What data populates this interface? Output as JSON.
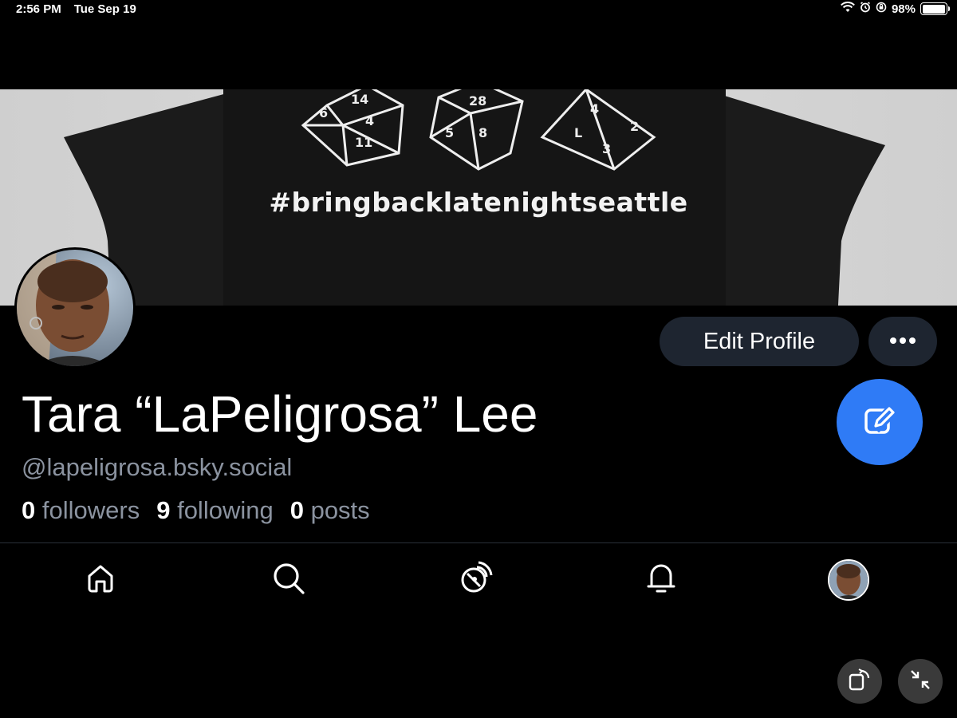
{
  "status_bar": {
    "time": "2:56 PM",
    "date": "Tue Sep 19",
    "battery": "98%",
    "battery_level": 0.98
  },
  "banner": {
    "hashtag": "#bringbacklatenightseattle"
  },
  "profile": {
    "display_name": "Tara “LaPeligrosa” Lee",
    "handle": "@lapeligrosa.bsky.social",
    "followers_count": "0",
    "followers_label": "followers",
    "following_count": "9",
    "following_label": "following",
    "posts_count": "0",
    "posts_label": "posts"
  },
  "actions": {
    "edit_profile": "Edit Profile",
    "more_icon": "ellipsis-icon"
  },
  "fab": {
    "icon": "compose-icon",
    "color": "#2f7bf6"
  },
  "tabbar": {
    "items": [
      {
        "name": "home",
        "icon": "home-icon"
      },
      {
        "name": "search",
        "icon": "search-icon"
      },
      {
        "name": "feeds",
        "icon": "satellite-dish-icon"
      },
      {
        "name": "notifications",
        "icon": "bell-icon"
      },
      {
        "name": "profile",
        "icon": "avatar"
      }
    ]
  },
  "colors": {
    "background": "#000000",
    "secondary_text": "#8b93a0",
    "button_bg": "#1e2530",
    "accent": "#2f7bf6"
  }
}
